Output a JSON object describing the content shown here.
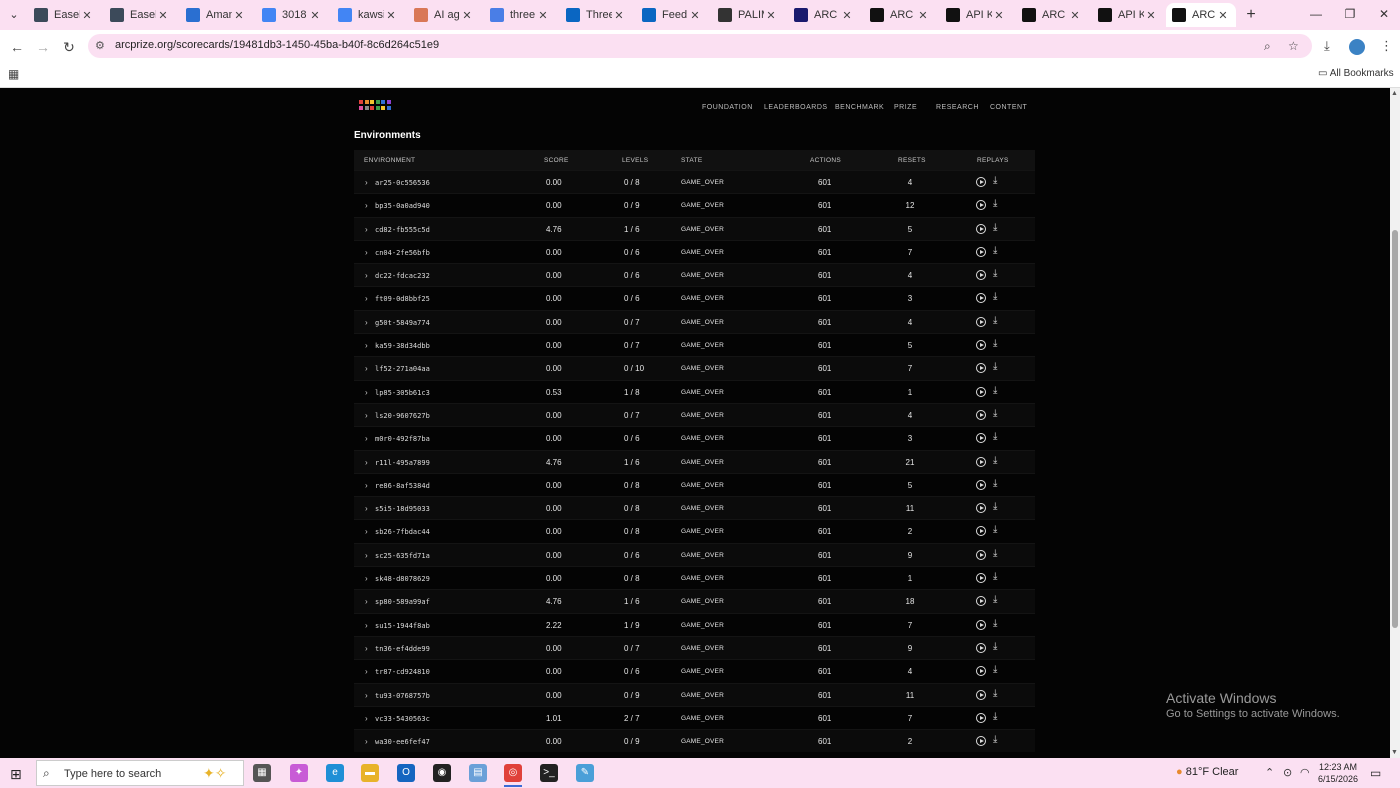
{
  "browser": {
    "tabs": [
      {
        "label": "Easel",
        "color": "#3c4a5a"
      },
      {
        "label": "Easel",
        "color": "#3c4a5a"
      },
      {
        "label": "Aman",
        "color": "#2a6fd1"
      },
      {
        "label": "3018",
        "color": "#4285f4"
      },
      {
        "label": "kawsi",
        "color": "#4285f4"
      },
      {
        "label": "AI age",
        "color": "#d97757"
      },
      {
        "label": "three",
        "color": "#4a7ee6"
      },
      {
        "label": "Three",
        "color": "#0a66c2"
      },
      {
        "label": "Feed |",
        "color": "#0a66c2"
      },
      {
        "label": "PALIM",
        "color": "#333333"
      },
      {
        "label": "ARC P",
        "color": "#1a1a6e"
      },
      {
        "label": "ARC P",
        "color": "#111111"
      },
      {
        "label": "API Ke",
        "color": "#111111"
      },
      {
        "label": "ARC P",
        "color": "#111111"
      },
      {
        "label": "API Ke",
        "color": "#111111"
      },
      {
        "label": "ARC P",
        "color": "#111111"
      }
    ],
    "url": "arcprize.org/scorecards/19481db3-1450-45ba-b40f-8c6d264c51e9",
    "bookmarks_label": "All Bookmarks"
  },
  "site": {
    "nav": [
      "FOUNDATION",
      "LEADERBOARDS",
      "BENCHMARK",
      "PRIZE",
      "RESEARCH",
      "CONTENT"
    ],
    "logo_colors": [
      "#e0413a",
      "#e88a2e",
      "#f2c530",
      "#3fa04b",
      "#2f6fd6",
      "#8f3fd1",
      "#e04fa0",
      "#888888",
      "#e0413a",
      "#3fa04b",
      "#f2c530",
      "#2f6fd6"
    ]
  },
  "section_title": "Environments",
  "table": {
    "headers": {
      "environment": "ENVIRONMENT",
      "score": "SCORE",
      "levels": "LEVELS",
      "state": "STATE",
      "actions": "ACTIONS",
      "resets": "RESETS",
      "replays": "REPLAYS"
    },
    "rows": [
      {
        "env": "ar25-0c556536",
        "score": "0.00",
        "levels": "0 / 8",
        "state": "GAME_OVER",
        "actions": "601",
        "resets": "4"
      },
      {
        "env": "bp35-0a0ad940",
        "score": "0.00",
        "levels": "0 / 9",
        "state": "GAME_OVER",
        "actions": "601",
        "resets": "12"
      },
      {
        "env": "cd82-fb555c5d",
        "score": "4.76",
        "levels": "1 / 6",
        "state": "GAME_OVER",
        "actions": "601",
        "resets": "5"
      },
      {
        "env": "cn04-2fe56bfb",
        "score": "0.00",
        "levels": "0 / 6",
        "state": "GAME_OVER",
        "actions": "601",
        "resets": "7"
      },
      {
        "env": "dc22-fdcac232",
        "score": "0.00",
        "levels": "0 / 6",
        "state": "GAME_OVER",
        "actions": "601",
        "resets": "4"
      },
      {
        "env": "ft09-0d8bbf25",
        "score": "0.00",
        "levels": "0 / 6",
        "state": "GAME_OVER",
        "actions": "601",
        "resets": "3"
      },
      {
        "env": "g50t-5849a774",
        "score": "0.00",
        "levels": "0 / 7",
        "state": "GAME_OVER",
        "actions": "601",
        "resets": "4"
      },
      {
        "env": "ka59-38d34dbb",
        "score": "0.00",
        "levels": "0 / 7",
        "state": "GAME_OVER",
        "actions": "601",
        "resets": "5"
      },
      {
        "env": "lf52-271a04aa",
        "score": "0.00",
        "levels": "0 / 10",
        "state": "GAME_OVER",
        "actions": "601",
        "resets": "7"
      },
      {
        "env": "lp85-305b61c3",
        "score": "0.53",
        "levels": "1 / 8",
        "state": "GAME_OVER",
        "actions": "601",
        "resets": "1"
      },
      {
        "env": "ls20-9607627b",
        "score": "0.00",
        "levels": "0 / 7",
        "state": "GAME_OVER",
        "actions": "601",
        "resets": "4"
      },
      {
        "env": "m0r0-492f87ba",
        "score": "0.00",
        "levels": "0 / 6",
        "state": "GAME_OVER",
        "actions": "601",
        "resets": "3"
      },
      {
        "env": "r11l-495a7899",
        "score": "4.76",
        "levels": "1 / 6",
        "state": "GAME_OVER",
        "actions": "601",
        "resets": "21"
      },
      {
        "env": "re86-8af5384d",
        "score": "0.00",
        "levels": "0 / 8",
        "state": "GAME_OVER",
        "actions": "601",
        "resets": "5"
      },
      {
        "env": "s5i5-18d95033",
        "score": "0.00",
        "levels": "0 / 8",
        "state": "GAME_OVER",
        "actions": "601",
        "resets": "11"
      },
      {
        "env": "sb26-7fbdac44",
        "score": "0.00",
        "levels": "0 / 8",
        "state": "GAME_OVER",
        "actions": "601",
        "resets": "2"
      },
      {
        "env": "sc25-635fd71a",
        "score": "0.00",
        "levels": "0 / 6",
        "state": "GAME_OVER",
        "actions": "601",
        "resets": "9"
      },
      {
        "env": "sk48-d8078629",
        "score": "0.00",
        "levels": "0 / 8",
        "state": "GAME_OVER",
        "actions": "601",
        "resets": "1"
      },
      {
        "env": "sp80-589a99af",
        "score": "4.76",
        "levels": "1 / 6",
        "state": "GAME_OVER",
        "actions": "601",
        "resets": "18"
      },
      {
        "env": "su15-1944f8ab",
        "score": "2.22",
        "levels": "1 / 9",
        "state": "GAME_OVER",
        "actions": "601",
        "resets": "7"
      },
      {
        "env": "tn36-ef4dde99",
        "score": "0.00",
        "levels": "0 / 7",
        "state": "GAME_OVER",
        "actions": "601",
        "resets": "9"
      },
      {
        "env": "tr87-cd924810",
        "score": "0.00",
        "levels": "0 / 6",
        "state": "GAME_OVER",
        "actions": "601",
        "resets": "4"
      },
      {
        "env": "tu93-0768757b",
        "score": "0.00",
        "levels": "0 / 9",
        "state": "GAME_OVER",
        "actions": "601",
        "resets": "11"
      },
      {
        "env": "vc33-5430563c",
        "score": "1.01",
        "levels": "2 / 7",
        "state": "GAME_OVER",
        "actions": "601",
        "resets": "7"
      },
      {
        "env": "wa30-ee6fef47",
        "score": "0.00",
        "levels": "0 / 9",
        "state": "GAME_OVER",
        "actions": "601",
        "resets": "2"
      }
    ]
  },
  "watermark": {
    "line1": "Activate Windows",
    "line2": "Go to Settings to activate Windows."
  },
  "taskbar": {
    "search_placeholder": "Type here to search",
    "weather": "81°F  Clear",
    "time": "12:23 AM",
    "date": "6/15/2026",
    "apps": [
      {
        "name": "task-view",
        "color": "#555555",
        "glyph": "▦"
      },
      {
        "name": "copilot",
        "color": "#c85bd6",
        "glyph": "✦"
      },
      {
        "name": "edge",
        "color": "#1f8fd6",
        "glyph": "e"
      },
      {
        "name": "file-explorer",
        "color": "#e8b32a",
        "glyph": "▬"
      },
      {
        "name": "outlook",
        "color": "#1565c0",
        "glyph": "O"
      },
      {
        "name": "github",
        "color": "#222222",
        "glyph": "◉"
      },
      {
        "name": "notepad",
        "color": "#6aa0d8",
        "glyph": "▤"
      },
      {
        "name": "chrome",
        "color": "#e0413a",
        "glyph": "◎"
      },
      {
        "name": "terminal",
        "color": "#222222",
        "glyph": ">_"
      },
      {
        "name": "paint",
        "color": "#4a9fd8",
        "glyph": "✎"
      }
    ]
  }
}
